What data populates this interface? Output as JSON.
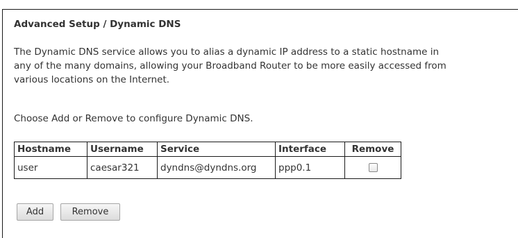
{
  "page": {
    "title": "Advanced Setup / Dynamic DNS",
    "description_lines": [
      "The Dynamic DNS service allows you to alias a dynamic IP address to a static hostname in",
      "any of the many domains, allowing your Broadband Router to be more easily accessed from",
      "various locations on the Internet."
    ],
    "instruction": "Choose Add or Remove to configure Dynamic DNS."
  },
  "table": {
    "headers": {
      "hostname": "Hostname",
      "username": "Username",
      "service": "Service",
      "interface": "Interface",
      "remove": "Remove"
    },
    "rows": [
      {
        "hostname": "user",
        "username": "caesar321",
        "service": "dyndns@dyndns.org",
        "interface": "ppp0.1",
        "remove_checked": false
      }
    ]
  },
  "buttons": {
    "add": "Add",
    "remove": "Remove"
  }
}
